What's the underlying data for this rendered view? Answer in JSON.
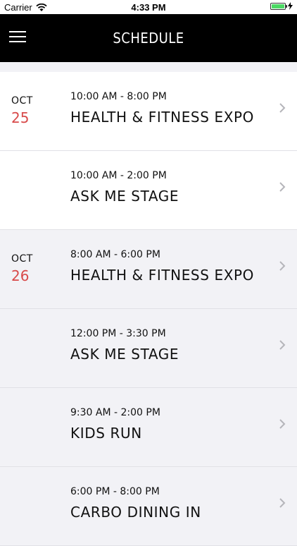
{
  "status_bar": {
    "carrier": "Carrier",
    "time": "4:33 PM"
  },
  "nav": {
    "title": "SCHEDULE"
  },
  "events": [
    {
      "month": "OCT",
      "day": "25",
      "time": "10:00 AM - 8:00 PM",
      "name": "HEALTH & FITNESS EXPO"
    },
    {
      "month": "",
      "day": "",
      "time": "10:00 AM - 2:00 PM",
      "name": "ASK ME STAGE"
    },
    {
      "month": "OCT",
      "day": "26",
      "time": "8:00 AM - 6:00 PM",
      "name": "HEALTH & FITNESS EXPO"
    },
    {
      "month": "",
      "day": "",
      "time": "12:00 PM - 3:30 PM",
      "name": "ASK ME STAGE"
    },
    {
      "month": "",
      "day": "",
      "time": "9:30 AM - 2:00 PM",
      "name": "KIDS RUN"
    },
    {
      "month": "",
      "day": "",
      "time": "6:00 PM - 8:00 PM",
      "name": "CARBO DINING IN"
    }
  ],
  "colors": {
    "accent": "#d84a4a",
    "nav_bg": "#000000",
    "battery": "#4cd964"
  }
}
